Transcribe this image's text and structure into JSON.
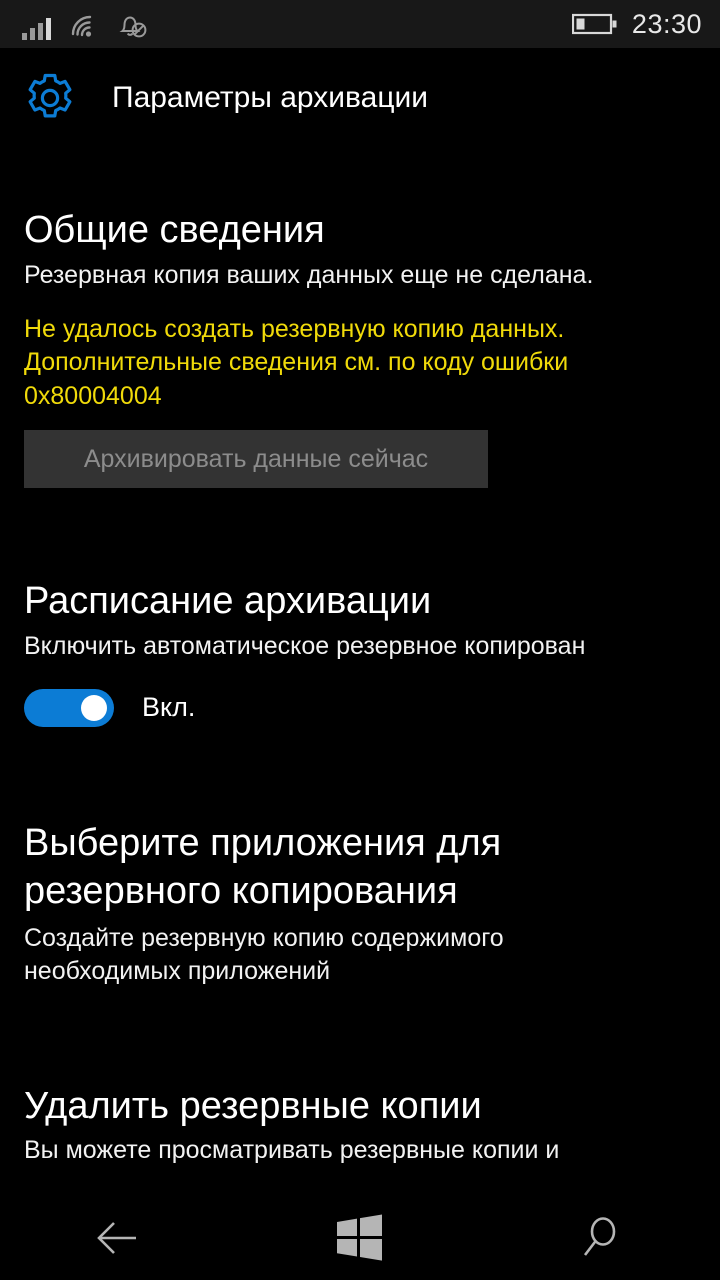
{
  "status_bar": {
    "signal_icon": "signal-bars-icon",
    "wifi_icon": "wifi-icon",
    "dnd_icon": "bell-disabled-icon",
    "battery_icon": "battery-low-icon",
    "time": "23:30"
  },
  "header": {
    "icon": "gear-icon",
    "title": "Параметры архивации",
    "accent_color": "#0c7cd5"
  },
  "sections": {
    "overview": {
      "heading": "Общие сведения",
      "subtitle": "Резервная копия ваших данных еще не сделана.",
      "error": "Не удалось создать резервную копию данных. Дополнительные сведения см. по коду ошибки 0x80004004",
      "error_color": "#F0DA0A",
      "button_label": "Архивировать данные сейчас",
      "button_enabled": "false"
    },
    "schedule": {
      "heading": "Расписание архивации",
      "subtitle": "Включить автоматическое резервное копирован",
      "toggle_state": "on",
      "toggle_label": "Вкл."
    },
    "apps": {
      "heading": "Выберите приложения для резервного копирования",
      "subtitle": "Создайте резервную копию содержимого необходимых приложений"
    },
    "delete": {
      "heading": "Удалить резервные копии",
      "subtitle": "Вы можете просматривать резервные копии и"
    }
  },
  "nav_bar": {
    "back": "back-arrow-icon",
    "home": "windows-logo-icon",
    "search": "search-icon"
  }
}
